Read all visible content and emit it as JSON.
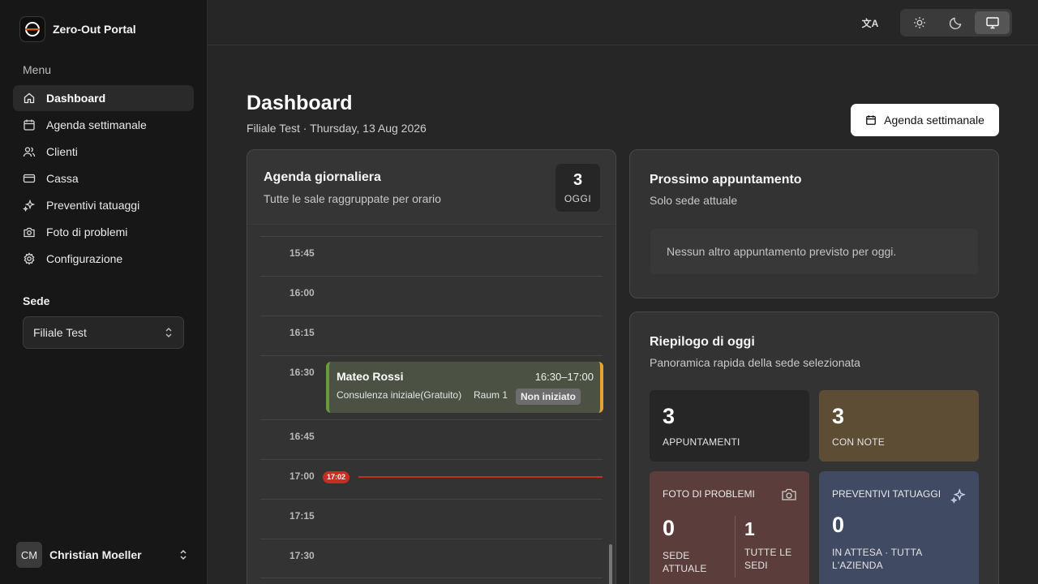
{
  "app": {
    "name": "Zero-Out Portal"
  },
  "sidebar": {
    "menu_label": "Menu",
    "items": [
      {
        "label": "Dashboard",
        "icon": "home-icon",
        "active": true
      },
      {
        "label": "Agenda settimanale",
        "icon": "calendar-icon"
      },
      {
        "label": "Clienti",
        "icon": "users-icon"
      },
      {
        "label": "Cassa",
        "icon": "credit-card-icon"
      },
      {
        "label": "Preventivi tatuaggi",
        "icon": "sparkles-icon"
      },
      {
        "label": "Foto di problemi",
        "icon": "camera-icon"
      },
      {
        "label": "Configurazione",
        "icon": "gear-icon"
      }
    ],
    "sede_label": "Sede",
    "sede_value": "Filiale Test",
    "user": {
      "initials": "CM",
      "name": "Christian Moeller"
    }
  },
  "topbar": {
    "translate_glyph": "文A",
    "theme_options": [
      "light",
      "dark",
      "system"
    ],
    "theme_selected": "system"
  },
  "header": {
    "title": "Dashboard",
    "subtitle": "Filiale Test · Thursday, 13 Aug 2026",
    "week_button": "Agenda settimanale"
  },
  "agenda": {
    "title": "Agenda giornaliera",
    "subtitle": "Tutte le sale raggruppate per orario",
    "count": "3",
    "count_label": "OGGI",
    "slots": [
      "15:45",
      "16:00",
      "16:15",
      "16:30",
      "16:45",
      "17:00",
      "17:15",
      "17:30"
    ],
    "appointment": {
      "name": "Mateo Rossi",
      "time": "16:30–17:00",
      "type": "Consulenza iniziale(Gratuito)",
      "room": "Raum 1",
      "status": "Non iniziato"
    },
    "now": "17:02"
  },
  "next_appointment": {
    "title": "Prossimo appuntamento",
    "subtitle": "Solo sede attuale",
    "empty_text": "Nessun altro appuntamento previsto per oggi."
  },
  "summary": {
    "title": "Riepilogo di oggi",
    "subtitle": "Panoramica rapida della sede selezionata",
    "appointments": {
      "value": "3",
      "label": "APPUNTAMENTI"
    },
    "with_notes": {
      "value": "3",
      "label": "CON NOTE"
    },
    "problem_photos": {
      "title": "FOTO DI PROBLEMI",
      "current": {
        "value": "0",
        "label": "SEDE ATTUALE"
      },
      "all": {
        "value": "1",
        "label": "TUTTE LE SEDI"
      }
    },
    "tattoo_quotes": {
      "title": "PREVENTIVI TATUAGGI",
      "value": "0",
      "label": "IN ATTESA · TUTTA L'AZIENDA"
    }
  },
  "colors": {
    "accent_green": "#6a9a3c",
    "accent_orange": "#e0a431",
    "now_red": "#c62d23",
    "notes_tile": "#5c4d34",
    "photos_tile": "#5b3e3b",
    "quotes_tile": "#414a63"
  }
}
